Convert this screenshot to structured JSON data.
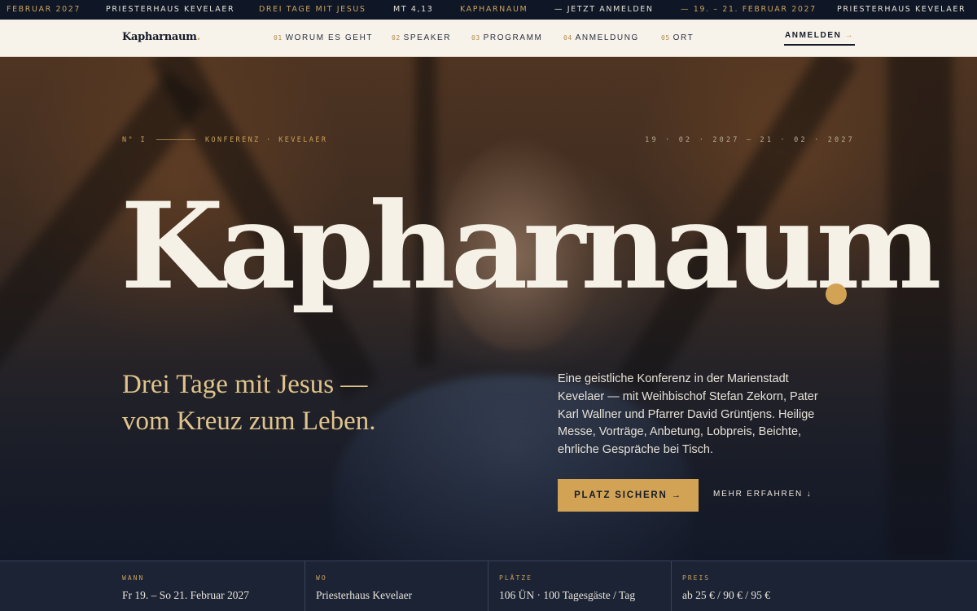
{
  "ticker": [
    {
      "text": "Februar 2027",
      "tone": "gold"
    },
    {
      "text": "Priesterhaus Kevelaer",
      "tone": "light"
    },
    {
      "text": "Drei Tage mit Jesus",
      "tone": "gold"
    },
    {
      "text": "Mt 4,13",
      "tone": "light"
    },
    {
      "text": "Kapharnaum",
      "tone": "gold"
    },
    {
      "text": "— Jetzt anmelden",
      "tone": "light"
    },
    {
      "text": "— 19. – 21. Februar 2027",
      "tone": "gold"
    },
    {
      "text": "Priesterhaus Kevelaer",
      "tone": "light"
    }
  ],
  "nav": {
    "brand": "Kapharnaum",
    "brand_dot": ".",
    "links": [
      {
        "num": "01",
        "label": "Worum es geht"
      },
      {
        "num": "02",
        "label": "Speaker"
      },
      {
        "num": "03",
        "label": "Programm"
      },
      {
        "num": "04",
        "label": "Anmeldung"
      },
      {
        "num": "05",
        "label": "Ort"
      }
    ],
    "cta": "ANMELDEN",
    "cta_arrow": "→"
  },
  "hero": {
    "eyebrow_number": "N° I",
    "eyebrow_text": "KONFERENZ · KEVELAER",
    "dates": "19 · 02 · 2027 — 21 · 02 · 2027",
    "headline": "Kapharnaum",
    "tagline_line1": "Drei Tage mit Jesus —",
    "tagline_line2": "vom Kreuz zum Leben.",
    "description": "Eine geistliche Konferenz in der Marienstadt Kevelaer — mit Weihbischof Stefan Zekorn, Pater Karl Wallner und Pfarrer David Grüntjens. Heilige Messe, Vorträge, Anbetung, Lobpreis, Beichte, ehrliche Gespräche bei Tisch.",
    "primary_button": "PLATZ SICHERN →",
    "secondary_button": "MEHR ERFAHREN ↓"
  },
  "info": [
    {
      "label": "WANN",
      "value": "Fr 19. – So 21. Februar 2027"
    },
    {
      "label": "WO",
      "value": "Priesterhaus Kevelaer"
    },
    {
      "label": "PLÄTZE",
      "value": "106 ÜN · 100 Tagesgäste / Tag"
    },
    {
      "label": "PREIS",
      "value": "ab 25 € / 90 € / 95 €"
    }
  ],
  "colors": {
    "gold": "#d3a355",
    "navy": "#151a28",
    "cream": "#f7f3ea"
  }
}
